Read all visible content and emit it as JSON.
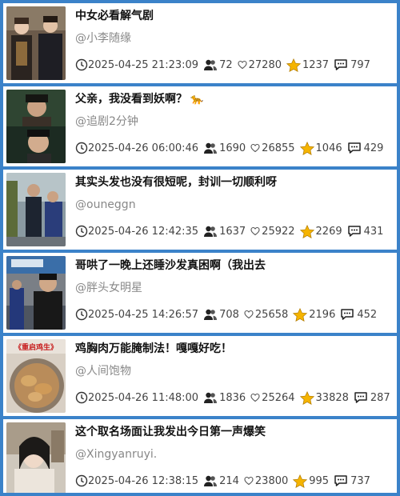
{
  "items": [
    {
      "title": "中女必看解气剧",
      "author": "@小李随缘",
      "time": "2025-04-25 21:23:09",
      "views": "72",
      "likes": "27280",
      "stars": "1237",
      "comments": "797",
      "title_emoji": ""
    },
    {
      "title": "父亲，我没看到妖啊？",
      "author": "@追剧2分钟",
      "time": "2025-04-26 06:00:46",
      "views": "1690",
      "likes": "26855",
      "stars": "1046",
      "comments": "429",
      "title_emoji": "🐆"
    },
    {
      "title": "其实头发也没有很短呢，封训一切顺利呀",
      "author": "@ouneggn",
      "time": "2025-04-26 12:42:35",
      "views": "1637",
      "likes": "25922",
      "stars": "2269",
      "comments": "431",
      "title_emoji": ""
    },
    {
      "title": "哥哄了一晚上还睡沙发真困啊（我出去",
      "author": "@胖头女明星",
      "time": "2025-04-25 14:26:57",
      "views": "708",
      "likes": "25658",
      "stars": "2196",
      "comments": "452",
      "title_emoji": ""
    },
    {
      "title": "鸡胸肉万能腌制法！嘎嘎好吃！",
      "author": "@人间饱物",
      "time": "2025-04-26 11:48:00",
      "views": "1836",
      "likes": "25264",
      "stars": "33828",
      "comments": "287",
      "title_emoji": "",
      "thumb_label": "《重启鸡生》"
    },
    {
      "title": "这个取名场面让我发出今日第一声爆笑",
      "author": "@Xingyanruyi.",
      "time": "2025-04-26 12:38:15",
      "views": "214",
      "likes": "23800",
      "stars": "995",
      "comments": "737",
      "title_emoji": ""
    }
  ],
  "icons": {
    "time": "clock-icon",
    "views": "people-icon",
    "likes": "heart-icon",
    "stars": "star-icon",
    "comments": "comment-icon"
  },
  "colors": {
    "border": "#3b82c9",
    "star": "#f5b400",
    "meta_text": "#444444",
    "author_text": "#888888"
  }
}
